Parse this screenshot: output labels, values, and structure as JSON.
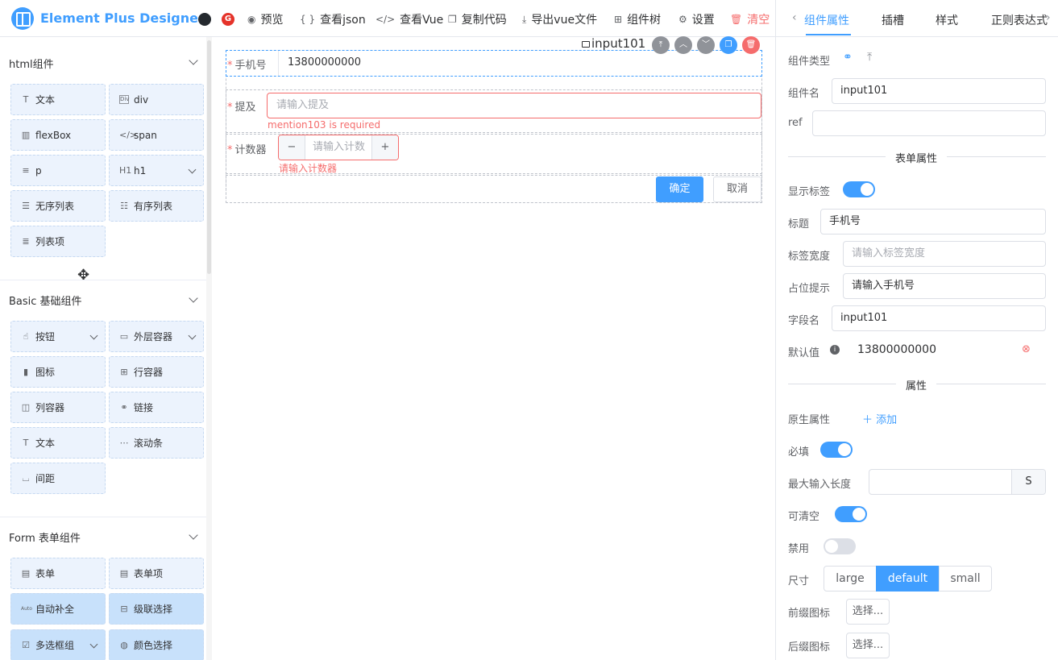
{
  "app": {
    "title": "Element Plus Designer"
  },
  "toolbar": {
    "preview": "预览",
    "view_json": "查看json",
    "view_vue": "查看Vue",
    "copy_code": "复制代码",
    "export_vue": "导出vue文件",
    "component_tree": "组件树",
    "settings": "设置",
    "clear": "清空"
  },
  "left": {
    "html_section": "html组件",
    "html_items": [
      "文本",
      "div",
      "flexBox",
      "span",
      "p",
      "h1",
      "无序列表",
      "有序列表",
      "列表项"
    ],
    "basic_section": "Basic 基础组件",
    "basic_items": [
      "按钮",
      "外层容器",
      "图标",
      "行容器",
      "列容器",
      "链接",
      "文本",
      "滚动条",
      "间距"
    ],
    "form_section": "Form 表单组件",
    "form_items": [
      "表单",
      "表单项",
      "自动补全",
      "级联选择",
      "多选框组",
      "颜色选择"
    ],
    "icons": {
      "h1": "H1",
      "div": "Div",
      "auto": "Auto"
    }
  },
  "canvas": {
    "selected_tag": "input101",
    "phone_label": "手机号",
    "phone_value": "13800000000",
    "mention_label": "提及",
    "mention_placeholder": "请输入提及",
    "mention_error": "mention103 is required",
    "counter_label": "计数器",
    "counter_placeholder": "请输入计数",
    "counter_error": "请输入计数器",
    "ok": "确定",
    "cancel": "取消"
  },
  "right": {
    "tabs": [
      "组件属性",
      "插槽",
      "样式",
      "正则表达式"
    ],
    "component_type_label": "组件类型",
    "component_name_label": "组件名",
    "component_name": "input101",
    "ref_label": "ref",
    "form_props_title": "表单属性",
    "show_label_label": "显示标签",
    "title_label": "标题",
    "title_value": "手机号",
    "label_width_label": "标签宽度",
    "label_width_placeholder": "请输入标签宽度",
    "placeholder_label": "占位提示",
    "placeholder_value": "请输入手机号",
    "field_label": "字段名",
    "field_value": "input101",
    "default_label": "默认值",
    "default_value": "13800000000",
    "props_title": "属性",
    "native_label": "原生属性",
    "add": "添加",
    "required_label": "必填",
    "maxlen_label": "最大输入长度",
    "maxlen_suffix": "S",
    "clearable_label": "可清空",
    "disabled_label": "禁用",
    "size_label": "尺寸",
    "sizes": [
      "large",
      "default",
      "small"
    ],
    "prefix_icon_label": "前缀图标",
    "suffix_icon_label": "后缀图标",
    "choose": "选择..."
  }
}
